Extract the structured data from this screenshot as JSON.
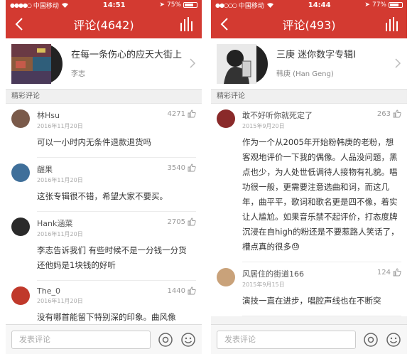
{
  "left": {
    "status": {
      "carrier": "中国移动",
      "time": "14:51",
      "battery": "75%",
      "battery_level": 0.75
    },
    "header": {
      "title": "评论(4642)"
    },
    "album": {
      "name": "在每一条伤心的应天大街上",
      "artist": "李志"
    },
    "section": "精彩评论",
    "comments": [
      {
        "user": "林Hsu",
        "date": "2016年11月20日",
        "likes": "4271",
        "text": "可以一小时内无条件退款退货吗",
        "avatar_color": "#7a5a4a"
      },
      {
        "user": "龌果",
        "date": "2016年11月20日",
        "likes": "3540",
        "text": "这张专辑很不错，希望大家不要买。",
        "avatar_color": "#3f6f9a"
      },
      {
        "user": "Hank涵菜",
        "date": "2016年11月20日",
        "likes": "2705",
        "text": "李志告诉我们 有些时候不是一分钱一分货 还他妈是1块钱的好听",
        "avatar_color": "#2a2a2a"
      },
      {
        "user": "The_0",
        "date": "2016年11月20日",
        "likes": "1440",
        "text": "没有哪首能留下特别深的印象。曲风像",
        "avatar_color": "#c0392b"
      }
    ],
    "input": {
      "placeholder": "发表评论"
    }
  },
  "right": {
    "status": {
      "carrier": "中国移动",
      "time": "14:44",
      "battery": "77%",
      "battery_level": 0.77
    },
    "header": {
      "title": "评论(493)"
    },
    "album": {
      "name": "三庚 迷你数字专辑I",
      "artist": "韩庚 (Han Geng)"
    },
    "section": "精彩评论",
    "comments": [
      {
        "user": "敢不好听你就死定了",
        "date": "2015年9月20日",
        "likes": "263",
        "text": "作为一个从2005年开始粉韩庚的老粉，想客观地评价一下我的偶像。人品没问题，黑点也少，为人处世低调待人接物有礼貌。唱功很一般，更需要注意选曲和词，而这几年，曲平平，歌词和歌名更是四不像，着实让人尴尬。如果音乐禁不起评价，打态度牌沉浸在自high的粉还是不要惹路人笑话了，槽点真的很多😓",
        "avatar_color": "#8a2a2a"
      },
      {
        "user": "风居住的街道166",
        "date": "2015年9月15日",
        "likes": "124",
        "text": "演技一直在进步，唱腔声线也在不断突",
        "avatar_color": "#c9a27a"
      }
    ],
    "input": {
      "placeholder": "发表评论"
    }
  }
}
